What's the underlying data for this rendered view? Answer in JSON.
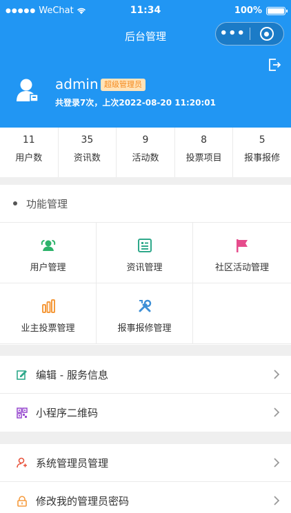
{
  "status_bar": {
    "carrier": "WeChat",
    "time": "11:34",
    "battery": "100%"
  },
  "nav": {
    "title": "后台管理"
  },
  "profile": {
    "username": "admin",
    "role_badge": "超级管理员",
    "login_info": "共登录7次，上次2022-08-20 11:20:01"
  },
  "stats": [
    {
      "value": "11",
      "label": "用户数"
    },
    {
      "value": "35",
      "label": "资讯数"
    },
    {
      "value": "9",
      "label": "活动数"
    },
    {
      "value": "8",
      "label": "投票项目"
    },
    {
      "value": "5",
      "label": "报事报修"
    }
  ],
  "function_section": {
    "title": "功能管理",
    "items": [
      {
        "label": "用户管理",
        "icon": "users-icon",
        "color": "#2db36a"
      },
      {
        "label": "资讯管理",
        "icon": "news-icon",
        "color": "#2ea88a"
      },
      {
        "label": "社区活动管理",
        "icon": "flag-icon",
        "color": "#e64c8c"
      },
      {
        "label": "业主投票管理",
        "icon": "bar-chart-icon",
        "color": "#f59a3c"
      },
      {
        "label": "报事报修管理",
        "icon": "tools-icon",
        "color": "#3d8fd6"
      }
    ]
  },
  "list1": [
    {
      "label": "编辑 - 服务信息",
      "icon": "edit-icon",
      "color": "#2ea88a"
    },
    {
      "label": "小程序二维码",
      "icon": "qrcode-icon",
      "color": "#9b4fd0"
    }
  ],
  "list2": [
    {
      "label": "系统管理员管理",
      "icon": "admin-user-icon",
      "color": "#e8533c"
    },
    {
      "label": "修改我的管理员密码",
      "icon": "lock-icon",
      "color": "#f59a3c"
    }
  ],
  "colors": {
    "primary": "#2196f3",
    "badge_bg": "#ffe3b8",
    "badge_text": "#f58a1f"
  }
}
